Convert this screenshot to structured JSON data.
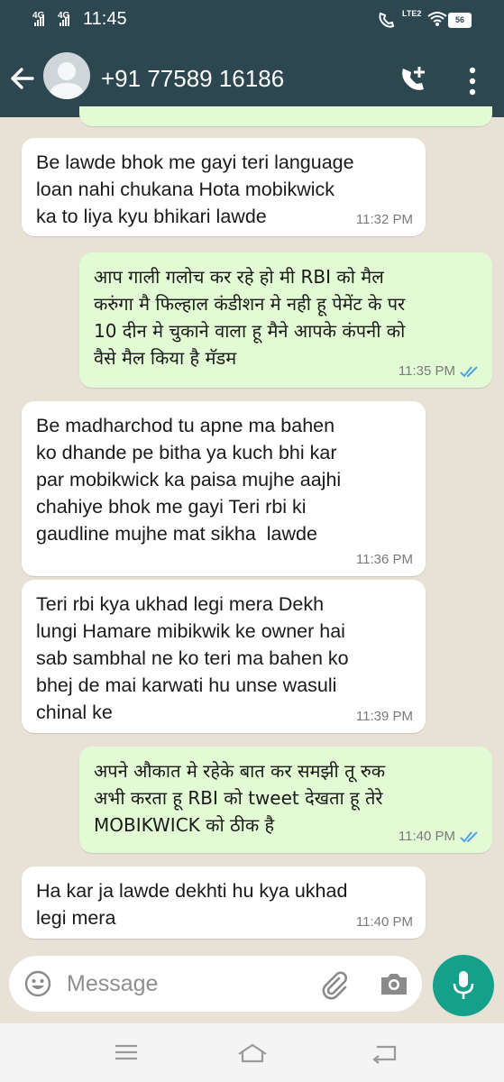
{
  "status_bar": {
    "network_1": "4G",
    "network_2": "4G",
    "time": "11:45",
    "volte": "LTE2",
    "battery": "56"
  },
  "header": {
    "contact": "+91 77589 16186",
    "icons": [
      "back-arrow-icon",
      "avatar",
      "add-call-icon",
      "more-vert-icon"
    ]
  },
  "messages": [
    {
      "direction": "in",
      "text": "Be lawde bhok me gayi teri language\nloan nahi chukana Hota mobikwick\nka to liya kyu bhikari lawde",
      "time": "11:32 PM"
    },
    {
      "direction": "out",
      "text": "आप गाली गलोच कर रहे हो मी RBI को मैल\nकरुंगा मै फिल्हाल कंडीशन मे नही हू पेमेंट के पर\n10 दीन मे चुकाने वाला हू मैने आपके कंपनी को\nवैसे मैल किया है मॅडम",
      "time": "11:35 PM",
      "status": "read"
    },
    {
      "direction": "in",
      "text": "Be madharchod tu apne ma bahen\nko dhande pe bitha ya kuch bhi kar\npar mobikwick ka paisa mujhe aajhi\nchahiye bhok me gayi Teri rbi ki\ngaudline mujhe mat sikha  lawde",
      "time": "11:36 PM"
    },
    {
      "direction": "in",
      "text": "Teri rbi kya ukhad legi mera Dekh\nlungi Hamare mibikwik ke owner hai\nsab sambhal ne ko teri ma bahen ko\nbhej de mai karwati hu unse wasuli\nchinal ke",
      "time": "11:39 PM"
    },
    {
      "direction": "out",
      "text": "अपने औकात मे रहेके बात कर समझी तू रुक\nअभी करता हू RBI को tweet देखता हू तेरे\nMOBIKWICK को ठीक है",
      "time": "11:40 PM",
      "status": "read"
    },
    {
      "direction": "in",
      "text": "Ha kar ja lawde dekhti hu kya ukhad\nlegi mera",
      "time": "11:40 PM"
    }
  ],
  "composer": {
    "placeholder": "Message",
    "icons": [
      "emoji-icon",
      "attach-icon",
      "camera-icon",
      "mic-icon"
    ]
  },
  "colors": {
    "header": "#2d4750",
    "incoming": "#ffffff",
    "outgoing": "#e3fbd4",
    "accent": "#14a08b",
    "read_ticks": "#4fa3e0"
  }
}
